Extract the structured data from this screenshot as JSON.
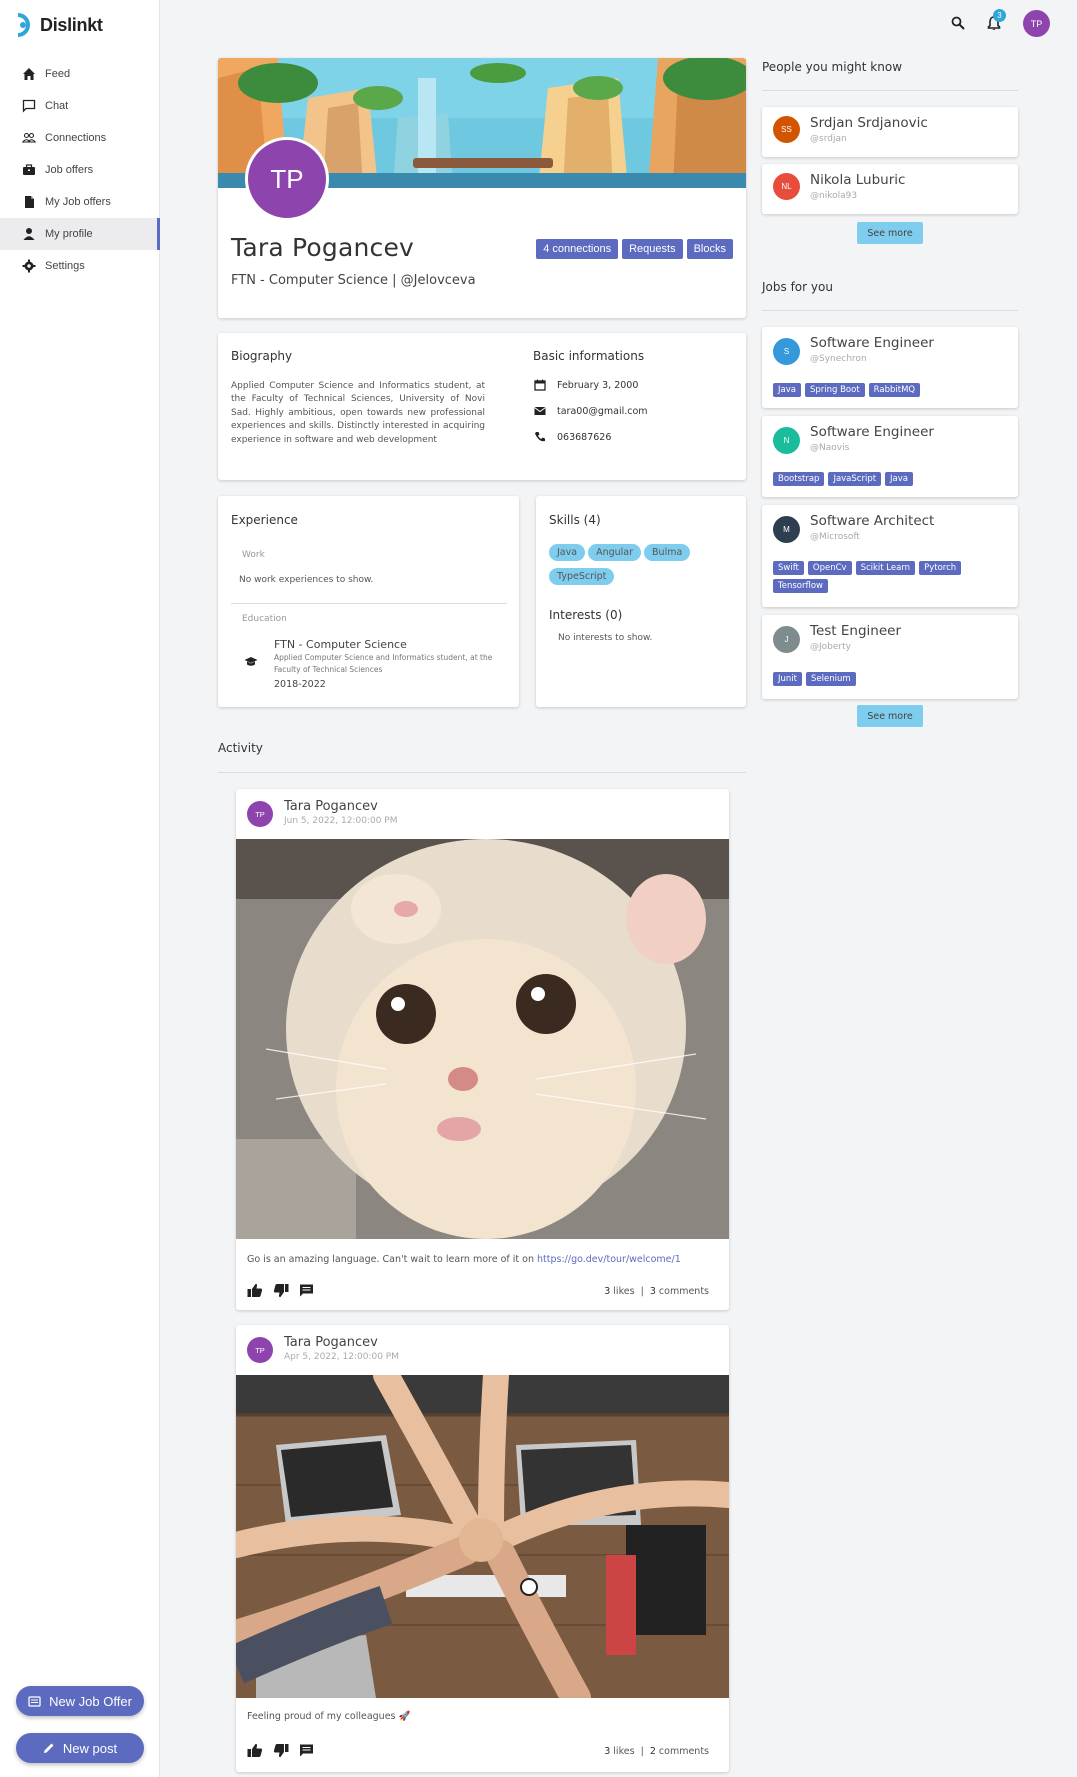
{
  "app": {
    "name": "Dislinkt"
  },
  "sidebar": {
    "items": [
      {
        "label": "Feed",
        "icon": "home-icon"
      },
      {
        "label": "Chat",
        "icon": "chat-icon"
      },
      {
        "label": "Connections",
        "icon": "people-icon"
      },
      {
        "label": "Job offers",
        "icon": "briefcase-icon"
      },
      {
        "label": "My Job offers",
        "icon": "document-icon"
      },
      {
        "label": "My profile",
        "icon": "person-icon",
        "active": true
      },
      {
        "label": "Settings",
        "icon": "gear-icon"
      }
    ],
    "new_job_offer_label": "New Job Offer",
    "new_post_label": "New post"
  },
  "topbar": {
    "notification_count": "3",
    "user_initials": "TP"
  },
  "profile": {
    "initials": "TP",
    "name": "Tara Pogancev",
    "subtitle": "FTN - Computer Science | @Jelovceva",
    "connections_label": "4 connections",
    "requests_label": "Requests",
    "blocks_label": "Blocks"
  },
  "biography": {
    "title": "Biography",
    "text": "Applied Computer Science and Informatics student, at the Faculty of Technical Sciences, University of Novi Sad. Highly ambitious, open towards new professional experiences and skills. Distinctly interested in acquiring experience in software and web development"
  },
  "basic_info": {
    "title": "Basic informations",
    "birthday": "February 3, 2000",
    "email": "tara00@gmail.com",
    "phone": "063687626"
  },
  "experience": {
    "title": "Experience",
    "work_label": "Work",
    "work_empty": "No work experiences to show.",
    "education_label": "Education",
    "education": {
      "school": "FTN - Computer Science",
      "description": "Applied Computer Science and Informatics student, at the Faculty of Technical Sciences",
      "years": "2018-2022"
    }
  },
  "skills": {
    "title": "Skills (4)",
    "items": [
      "Java",
      "Angular",
      "Bulma",
      "TypeScript"
    ]
  },
  "interests": {
    "title": "Interests (0)",
    "empty": "No interests to show."
  },
  "activity": {
    "title": "Activity",
    "posts": [
      {
        "initials": "TP",
        "author": "Tara Pogancev",
        "date": "Jun 5, 2022, 12:00:00 PM",
        "text": "Go is an amazing language. Can't wait to learn more of it on ",
        "link": "https://go.dev/tour/welcome/1",
        "likes": "3",
        "likes_label": "likes",
        "comments": "3",
        "comments_label": "comments"
      },
      {
        "initials": "TP",
        "author": "Tara Pogancev",
        "date": "Apr 5, 2022, 12:00:00 PM",
        "text": "Feeling proud of my colleagues 🚀",
        "likes": "3",
        "likes_label": "likes",
        "comments": "2",
        "comments_label": "comments"
      }
    ]
  },
  "people": {
    "title": "People you might know",
    "items": [
      {
        "initials": "SS",
        "name": "Srdjan Srdjanovic",
        "handle": "@srdjan",
        "color": "#d35400"
      },
      {
        "initials": "NL",
        "name": "Nikola Luburic",
        "handle": "@nikola93",
        "color": "#e74c3c"
      }
    ],
    "see_more": "See more"
  },
  "jobs": {
    "title": "Jobs for you",
    "items": [
      {
        "initials": "S",
        "title": "Software Engineer",
        "company": "@Synechron",
        "color": "#3498db",
        "tags": [
          "Java",
          "Spring Boot",
          "RabbitMQ"
        ]
      },
      {
        "initials": "N",
        "title": "Software Engineer",
        "company": "@Naovis",
        "color": "#1abc9c",
        "tags": [
          "Bootstrap",
          "JavaScript",
          "Java"
        ]
      },
      {
        "initials": "M",
        "title": "Software Architect",
        "company": "@Microsoft",
        "color": "#2c3e50",
        "tags": [
          "Swift",
          "OpenCv",
          "Scikit Learn",
          "Pytorch",
          "Tensorflow"
        ]
      },
      {
        "initials": "J",
        "title": "Test Engineer",
        "company": "@Joberty",
        "color": "#7f8c8d",
        "tags": [
          "Junit",
          "Selenium"
        ]
      }
    ],
    "see_more": "See more"
  }
}
